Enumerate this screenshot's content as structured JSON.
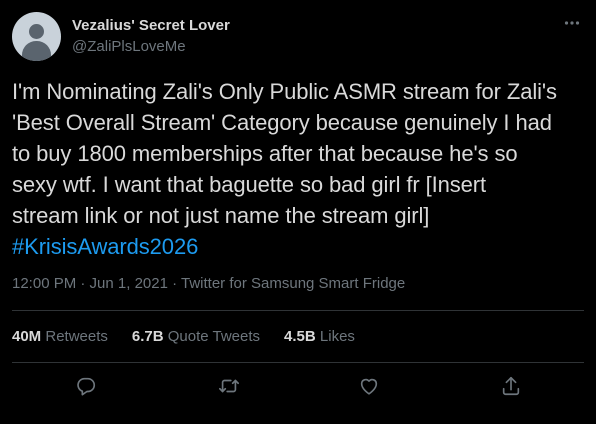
{
  "user": {
    "display_name": "Vezalius' Secret Lover",
    "handle": "@ZaliPlsLoveMe",
    "more_icon": "more-horizontal-icon"
  },
  "tweet": {
    "lines": [
      "I'm Nominating Zali's Only Public ASMR stream for Zali's",
      "'Best Overall Stream' Category because genuinely I had",
      "to buy 1800 memberships after that because he's so",
      "sexy wtf. I want that baguette so bad girl fr [Insert",
      "stream link or not just name the stream girl]"
    ],
    "hashtag": "#KrisisAwards2026"
  },
  "meta": {
    "timestamp": "12:00 PM · Jun 1, 2021 · ",
    "source": "Twitter for Samsung Smart Fridge"
  },
  "stats": {
    "retweets_count": "40M",
    "retweets_label": "Retweets",
    "quotes_count": "6.7B",
    "quotes_label": "Quote Tweets",
    "likes_count": "4.5B",
    "likes_label": "Likes"
  },
  "actions": {
    "icons": [
      "reply-icon",
      "retweet-icon",
      "like-icon",
      "share-icon"
    ]
  },
  "colors": {
    "background": "#000000",
    "text": "#d9d9d9",
    "secondary": "#6e767d",
    "accent": "#1d9bf0",
    "divider": "#2f3336"
  }
}
